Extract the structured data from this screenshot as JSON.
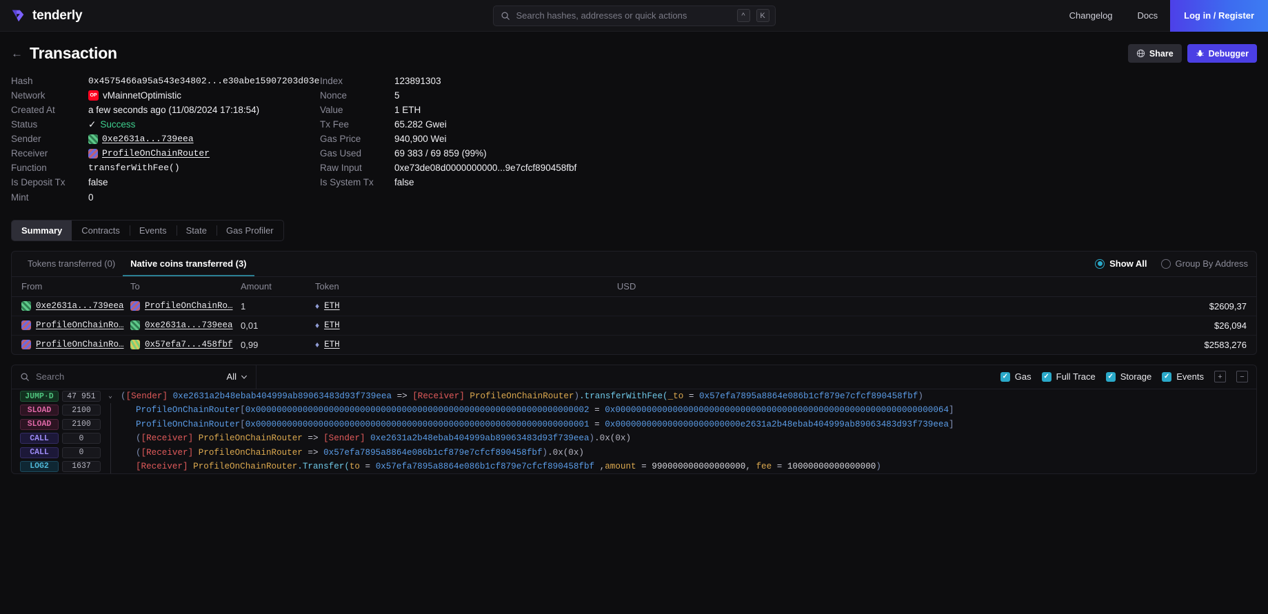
{
  "topbar": {
    "brand": "tenderly",
    "search": {
      "placeholder": "Search hashes, addresses or quick actions",
      "value": "",
      "kbd1": "^",
      "kbd2": "K"
    },
    "links": [
      {
        "label": "Changelog"
      },
      {
        "label": "Docs"
      }
    ],
    "login_label": "Log in / Register"
  },
  "header": {
    "title": "Transaction",
    "share_label": "Share",
    "debugger_label": "Debugger"
  },
  "details": {
    "left": [
      {
        "label": "Hash",
        "value": "0x4575466a95a543e34802...e30abe15907203d03e",
        "style": "mono"
      },
      {
        "label": "Network",
        "value": "vMainnetOptimistic",
        "icon": "optimism-badge"
      },
      {
        "label": "Created At",
        "value": "a few seconds ago (11/08/2024 17:18:54)"
      },
      {
        "label": "Status",
        "value": "Success",
        "style": "status-ok"
      },
      {
        "label": "Sender",
        "value": "0xe2631a...739eea",
        "style": "mono-link",
        "icon": "avatar-green"
      },
      {
        "label": "Receiver",
        "value": "ProfileOnChainRouter",
        "style": "mono-link",
        "icon": "avatar-blue"
      },
      {
        "label": "Function",
        "value": "transferWithFee()",
        "style": "mono"
      },
      {
        "label": "Is Deposit Tx",
        "value": "false"
      },
      {
        "label": "Mint",
        "value": "0"
      }
    ],
    "right": [
      {
        "label": "Index",
        "value": "123891303"
      },
      {
        "label": "Nonce",
        "value": "5"
      },
      {
        "label": "Value",
        "value": "1 ETH"
      },
      {
        "label": "Tx Fee",
        "value": "65.282 Gwei"
      },
      {
        "label": "Gas Price",
        "value": "940,900 Wei"
      },
      {
        "label": "Gas Used",
        "value": "69 383 / 69 859 (99%)"
      },
      {
        "label": "Raw Input",
        "value": "0xe73de08d0000000000...9e7cfcf890458fbf"
      },
      {
        "label": "Is System Tx",
        "value": "false"
      }
    ]
  },
  "main_tabs": [
    {
      "label": "Summary",
      "active": true
    },
    {
      "label": "Contracts",
      "active": false
    },
    {
      "label": "Events",
      "active": false
    },
    {
      "label": "State",
      "active": false
    },
    {
      "label": "Gas Profiler",
      "active": false
    }
  ],
  "transfers_panel": {
    "subtabs": [
      {
        "label": "Tokens transferred (0)",
        "active": false
      },
      {
        "label": "Native coins transferred (3)",
        "active": true
      }
    ],
    "radios": [
      {
        "label": "Show All",
        "selected": true
      },
      {
        "label": "Group By Address",
        "selected": false
      }
    ],
    "columns": [
      "From",
      "To",
      "Amount",
      "Token",
      "USD"
    ],
    "rows": [
      {
        "from": "0xe2631a...739eea",
        "from_avatar": "avatar-green",
        "to": "ProfileOnChainRo…",
        "to_avatar": "avatar-blue",
        "amount": "1",
        "token": "ETH",
        "usd": "$2609,37"
      },
      {
        "from": "ProfileOnChainRo…",
        "from_avatar": "avatar-blue",
        "to": "0xe2631a...739eea",
        "to_avatar": "avatar-green",
        "amount": "0,01",
        "token": "ETH",
        "usd": "$26,094"
      },
      {
        "from": "ProfileOnChainRo…",
        "from_avatar": "avatar-blue",
        "to": "0x57efa7...458fbf",
        "to_avatar": "avatar-multi",
        "amount": "0,99",
        "token": "ETH",
        "usd": "$2583,276"
      }
    ]
  },
  "trace": {
    "search_placeholder": "Search",
    "search_value": "",
    "filter_label": "All",
    "toggles": [
      {
        "label": "Gas",
        "checked": true
      },
      {
        "label": "Full Trace",
        "checked": true
      },
      {
        "label": "Storage",
        "checked": true
      },
      {
        "label": "Events",
        "checked": true
      }
    ],
    "expand_all_label": "+",
    "collapse_all_label": "−",
    "rows": [
      {
        "op": "JUMP·D",
        "op_class": "op-jump",
        "gas": "47 951",
        "indent": 0,
        "caret": "v",
        "segments": [
          {
            "t": "(",
            "c": "t-paren"
          },
          {
            "t": "[Sender] ",
            "c": "t-sender"
          },
          {
            "t": "0xe2631a2b48ebab404999ab89063483d93f739eea",
            "c": "t-addr"
          },
          {
            "t": " => ",
            "c": "t-arrow"
          },
          {
            "t": "[Receiver] ",
            "c": "t-recv"
          },
          {
            "t": "ProfileOnChainRouter",
            "c": "t-ctr"
          },
          {
            "t": ")",
            "c": "t-paren"
          },
          {
            "t": ".transferWithFee(",
            "c": "t-fn"
          },
          {
            "t": "_to",
            "c": "t-param"
          },
          {
            "t": " = ",
            "c": "t-eq"
          },
          {
            "t": "0x57efa7895a8864e086b1cf879e7cfcf890458fbf",
            "c": "t-addr"
          },
          {
            "t": ")",
            "c": "t-paren"
          }
        ]
      },
      {
        "op": "SLOAD",
        "op_class": "op-sload",
        "gas": "2100",
        "indent": 1,
        "caret": "",
        "segments": [
          {
            "t": "ProfileOnChainRouter",
            "c": "t-addr"
          },
          {
            "t": "[",
            "c": "t-paren"
          },
          {
            "t": "0x0000000000000000000000000000000000000000000000000000000000000002",
            "c": "t-hex"
          },
          {
            "t": " = ",
            "c": "t-eq"
          },
          {
            "t": "0x0000000000000000000000000000000000000000000000000000000000000064",
            "c": "t-hex"
          },
          {
            "t": "]",
            "c": "t-paren"
          }
        ]
      },
      {
        "op": "SLOAD",
        "op_class": "op-sload",
        "gas": "2100",
        "indent": 1,
        "caret": "",
        "segments": [
          {
            "t": "ProfileOnChainRouter",
            "c": "t-addr"
          },
          {
            "t": "[",
            "c": "t-paren"
          },
          {
            "t": "0x0000000000000000000000000000000000000000000000000000000000000001",
            "c": "t-hex"
          },
          {
            "t": " = ",
            "c": "t-eq"
          },
          {
            "t": "0x000000000000000000000000e2631a2b48ebab404999ab89063483d93f739eea",
            "c": "t-hex"
          },
          {
            "t": "]",
            "c": "t-paren"
          }
        ]
      },
      {
        "op": "CALL",
        "op_class": "op-call",
        "gas": "0",
        "indent": 1,
        "caret": "",
        "segments": [
          {
            "t": "(",
            "c": "t-paren"
          },
          {
            "t": "[Receiver] ",
            "c": "t-recv"
          },
          {
            "t": "ProfileOnChainRouter",
            "c": "t-ctr"
          },
          {
            "t": " => ",
            "c": "t-arrow"
          },
          {
            "t": "[Sender] ",
            "c": "t-sender"
          },
          {
            "t": "0xe2631a2b48ebab404999ab89063483d93f739eea",
            "c": "t-addr"
          },
          {
            "t": ")",
            "c": "t-paren"
          },
          {
            "t": ".0x(0x)",
            "c": "t-plain"
          }
        ]
      },
      {
        "op": "CALL",
        "op_class": "op-call",
        "gas": "0",
        "indent": 1,
        "caret": "",
        "segments": [
          {
            "t": "(",
            "c": "t-paren"
          },
          {
            "t": "[Receiver] ",
            "c": "t-recv"
          },
          {
            "t": "ProfileOnChainRouter",
            "c": "t-ctr"
          },
          {
            "t": " => ",
            "c": "t-arrow"
          },
          {
            "t": "0x57efa7895a8864e086b1cf879e7cfcf890458fbf",
            "c": "t-addr"
          },
          {
            "t": ")",
            "c": "t-paren"
          },
          {
            "t": ".0x(0x)",
            "c": "t-plain"
          }
        ]
      },
      {
        "op": "LOG2",
        "op_class": "op-log2",
        "gas": "1637",
        "indent": 1,
        "caret": "",
        "segments": [
          {
            "t": "[Receiver] ",
            "c": "t-recv"
          },
          {
            "t": "ProfileOnChainRouter",
            "c": "t-ctr"
          },
          {
            "t": ".Transfer(",
            "c": "t-fn"
          },
          {
            "t": "to",
            "c": "t-param"
          },
          {
            "t": " = ",
            "c": "t-eq"
          },
          {
            "t": "0x57efa7895a8864e086b1cf879e7cfcf890458fbf",
            "c": "t-addr"
          },
          {
            "t": " ,",
            "c": "t-plain"
          },
          {
            "t": "amount",
            "c": "t-param"
          },
          {
            "t": " = ",
            "c": "t-eq"
          },
          {
            "t": "990000000000000000",
            "c": "t-num"
          },
          {
            "t": ", ",
            "c": "t-plain"
          },
          {
            "t": "fee",
            "c": "t-param"
          },
          {
            "t": " = ",
            "c": "t-eq"
          },
          {
            "t": "10000000000000000",
            "c": "t-num"
          },
          {
            "t": ")",
            "c": "t-paren"
          }
        ]
      }
    ]
  }
}
